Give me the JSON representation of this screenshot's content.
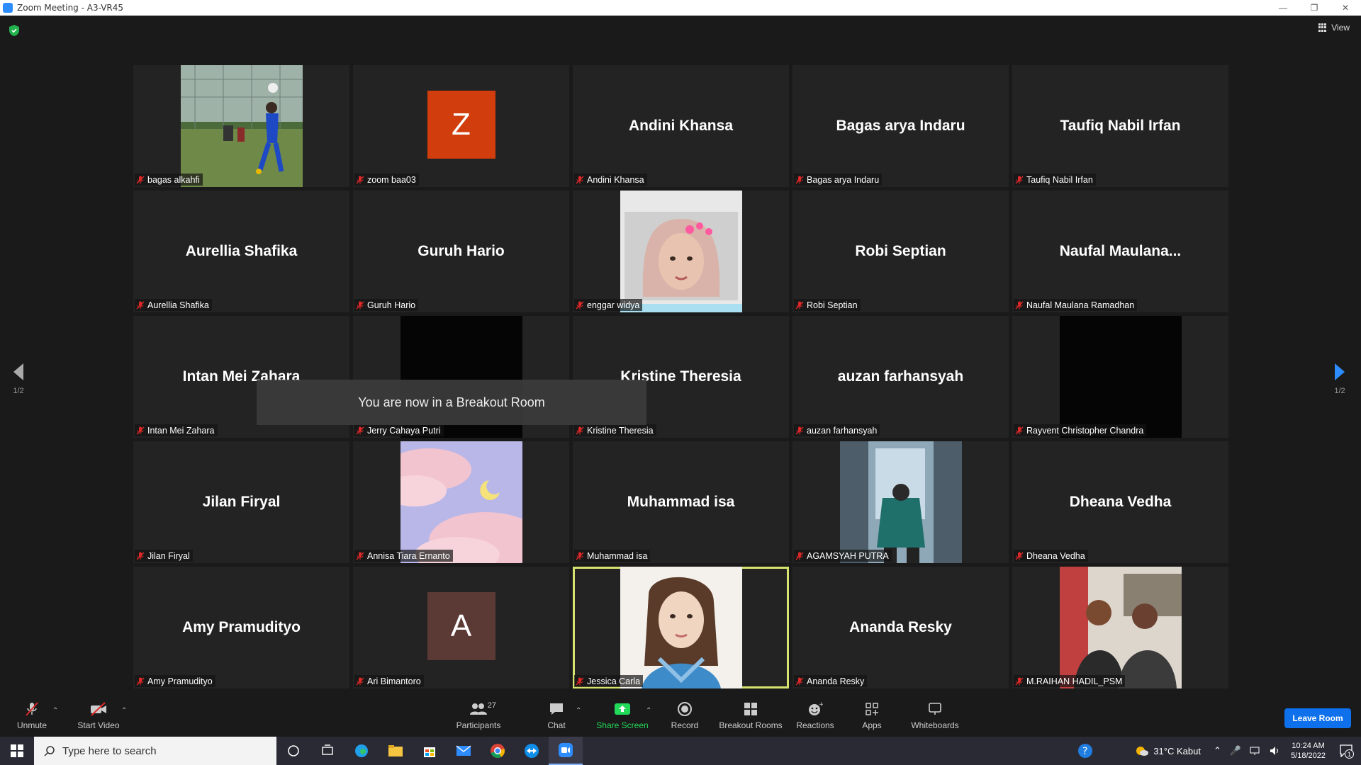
{
  "window": {
    "title": "Zoom Meeting - A3-VR45",
    "minimize_icon": "minimize-icon",
    "restore_icon": "restore-icon",
    "close_icon": "close-icon"
  },
  "top": {
    "view_label": "View"
  },
  "tiles": [
    {
      "label": "bagas alkahfi",
      "big_name": "",
      "kind": "photo",
      "photo": "soccer"
    },
    {
      "label": "zoom baa03",
      "big_name": "",
      "kind": "avatar",
      "initial": "Z",
      "color": "#d13d0c"
    },
    {
      "label": "Andini Khansa",
      "big_name": "Andini Khansa",
      "kind": "name"
    },
    {
      "label": "Bagas arya Indaru",
      "big_name": "Bagas arya Indaru",
      "kind": "name"
    },
    {
      "label": "Taufiq Nabil Irfan",
      "big_name": "Taufiq Nabil Irfan",
      "kind": "name"
    },
    {
      "label": "Aurellia Shafika",
      "big_name": "Aurellia Shafika",
      "kind": "name"
    },
    {
      "label": "Guruh Hario",
      "big_name": "Guruh Hario",
      "kind": "name"
    },
    {
      "label": "enggar widya",
      "big_name": "",
      "kind": "photo",
      "photo": "hijab"
    },
    {
      "label": "Robi Septian",
      "big_name": "Robi Septian",
      "kind": "name"
    },
    {
      "label": "Naufal Maulana Ramadhan",
      "big_name": "Naufal  Maulana...",
      "kind": "name"
    },
    {
      "label": "Intan Mei Zahara",
      "big_name": "Intan Mei Zahara",
      "kind": "name"
    },
    {
      "label": "Jerry Cahaya Putri",
      "big_name": "",
      "kind": "photo",
      "photo": "black"
    },
    {
      "label": "Kristine Theresia",
      "big_name": "Kristine Theresia",
      "kind": "name"
    },
    {
      "label": "auzan farhansyah",
      "big_name": "auzan farhansyah",
      "kind": "name"
    },
    {
      "label": "Rayvent Christopher Chandra",
      "big_name": "",
      "kind": "photo",
      "photo": "black"
    },
    {
      "label": "Jilan Firyal",
      "big_name": "Jilan Firyal",
      "kind": "name"
    },
    {
      "label": "Annisa Tiara Ernanto",
      "big_name": "",
      "kind": "photo",
      "photo": "clouds"
    },
    {
      "label": "Muhammad isa",
      "big_name": "Muhammad isa",
      "kind": "name"
    },
    {
      "label": "AGAMSYAH PUTRA",
      "big_name": "",
      "kind": "photo",
      "photo": "city"
    },
    {
      "label": "Dheana Vedha",
      "big_name": "Dheana Vedha",
      "kind": "name"
    },
    {
      "label": "Amy Pramudityo",
      "big_name": "Amy Pramudityo",
      "kind": "name"
    },
    {
      "label": "Ari Bimantoro",
      "big_name": "",
      "kind": "avatar",
      "initial": "A",
      "color": "#5b3a35"
    },
    {
      "label": "Jessica Carla",
      "big_name": "",
      "kind": "photo",
      "photo": "portrait",
      "active": true
    },
    {
      "label": "Ananda Resky",
      "big_name": "Ananda Resky",
      "kind": "name"
    },
    {
      "label": "M.RAIHAN HADIL_PSM",
      "big_name": "",
      "kind": "photo",
      "photo": "duo"
    }
  ],
  "toast": "You are now in a Breakout Room",
  "pager": {
    "left": "1/2",
    "right": "1/2"
  },
  "toolbar": {
    "unmute": "Unmute",
    "start_video": "Start Video",
    "participants": "Participants",
    "participant_count": "27",
    "chat": "Chat",
    "share_screen": "Share Screen",
    "record": "Record",
    "breakout_rooms": "Breakout Rooms",
    "reactions": "Reactions",
    "apps": "Apps",
    "whiteboards": "Whiteboards",
    "leave": "Leave Room"
  },
  "taskbar": {
    "search_placeholder": "Type here to search",
    "weather": "31°C  Kabut",
    "time": "10:24 AM",
    "date": "5/18/2022",
    "notification_count": "1"
  },
  "colors": {
    "accent_blue": "#0e71eb",
    "share_green": "#23d959",
    "active_speaker": "#d6e36e",
    "mute_red": "#e02828"
  }
}
